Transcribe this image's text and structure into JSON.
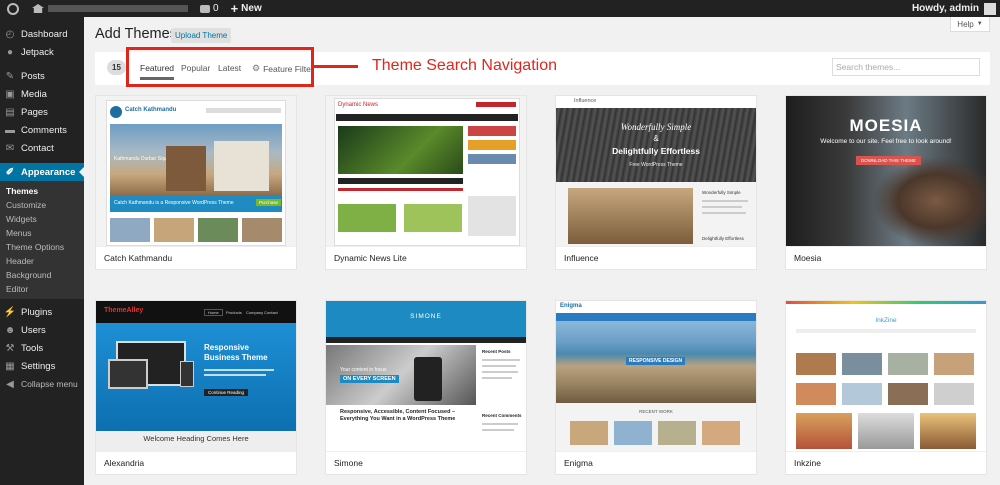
{
  "adminbar": {
    "comments_count": "0",
    "new_label": "New",
    "greeting": "Howdy, admin"
  },
  "sidebar": {
    "items": [
      {
        "label": "Dashboard",
        "icon": "dashboard-icon"
      },
      {
        "label": "Jetpack",
        "icon": "jetpack-icon"
      },
      {
        "label": "Posts",
        "icon": "pin-icon"
      },
      {
        "label": "Media",
        "icon": "media-icon"
      },
      {
        "label": "Pages",
        "icon": "pages-icon"
      },
      {
        "label": "Comments",
        "icon": "comment-icon"
      },
      {
        "label": "Contact",
        "icon": "contact-icon"
      },
      {
        "label": "Appearance",
        "icon": "brush-icon"
      },
      {
        "label": "Plugins",
        "icon": "plugin-icon"
      },
      {
        "label": "Users",
        "icon": "users-icon"
      },
      {
        "label": "Tools",
        "icon": "wrench-icon"
      },
      {
        "label": "Settings",
        "icon": "settings-icon"
      },
      {
        "label": "Collapse menu",
        "icon": "collapse-icon"
      }
    ],
    "appearance_sub": [
      "Themes",
      "Customize",
      "Widgets",
      "Menus",
      "Theme Options",
      "Header",
      "Background",
      "Editor"
    ]
  },
  "header": {
    "title": "Add Themes",
    "upload_label": "Upload Theme",
    "help_label": "Help"
  },
  "filter": {
    "count": "15",
    "tabs": [
      "Featured",
      "Popular",
      "Latest",
      "Feature Filter"
    ],
    "search_placeholder": "Search themes..."
  },
  "annotation": {
    "label": "Theme Search Navigation",
    "color": "#e0261c"
  },
  "themes": [
    {
      "name": "Catch Kathmandu"
    },
    {
      "name": "Dynamic News Lite"
    },
    {
      "name": "Influence"
    },
    {
      "name": "Moesia"
    },
    {
      "name": "Alexandria"
    },
    {
      "name": "Simone"
    },
    {
      "name": "Enigma"
    },
    {
      "name": "Inkzine"
    }
  ],
  "screenshots": {
    "catch": {
      "logo": "Catch Kathmandu",
      "caption": "Kathmandu Durbar Square",
      "banner": "Catch Kathmandu is a Responsive WordPress Theme",
      "btn": "Purchase"
    },
    "dynamic": {
      "logo": "Dynamic News"
    },
    "influence": {
      "logo": "Influence",
      "line1": "Wonderfully Simple",
      "amp": "&",
      "line2": "Delightfully Effortless",
      "sub": "Free WordPress Theme",
      "side1": "Wonderfully Simple",
      "side2": "Delightfully Effortless"
    },
    "moesia": {
      "title": "MOESIA",
      "tag": "Welcome to our site. Feel free to look around!",
      "btn": "DOWNLOAD THIS THEME"
    },
    "alexandria": {
      "logo": "ThemeAlley",
      "nav": [
        "Home",
        "Products",
        "Company",
        "Contact"
      ],
      "title": "Responsive Business Theme",
      "btn": "Continue Reading",
      "welcome": "Welcome Heading Comes Here"
    },
    "simone": {
      "logo": "SIMONE",
      "focus": "Your content in focus",
      "every": "ON EVERY SCREEN",
      "headline": "Responsive, Accessible, Content Focused – Everything You Want in a WordPress Theme",
      "recent": "Recent Posts",
      "comments": "Recent Comments"
    },
    "enigma": {
      "logo": "Enigma",
      "banner": "RESPONSIVE DESIGN",
      "section": "RECENT WORK"
    },
    "inkzine": {
      "logo": "InkZine"
    }
  }
}
